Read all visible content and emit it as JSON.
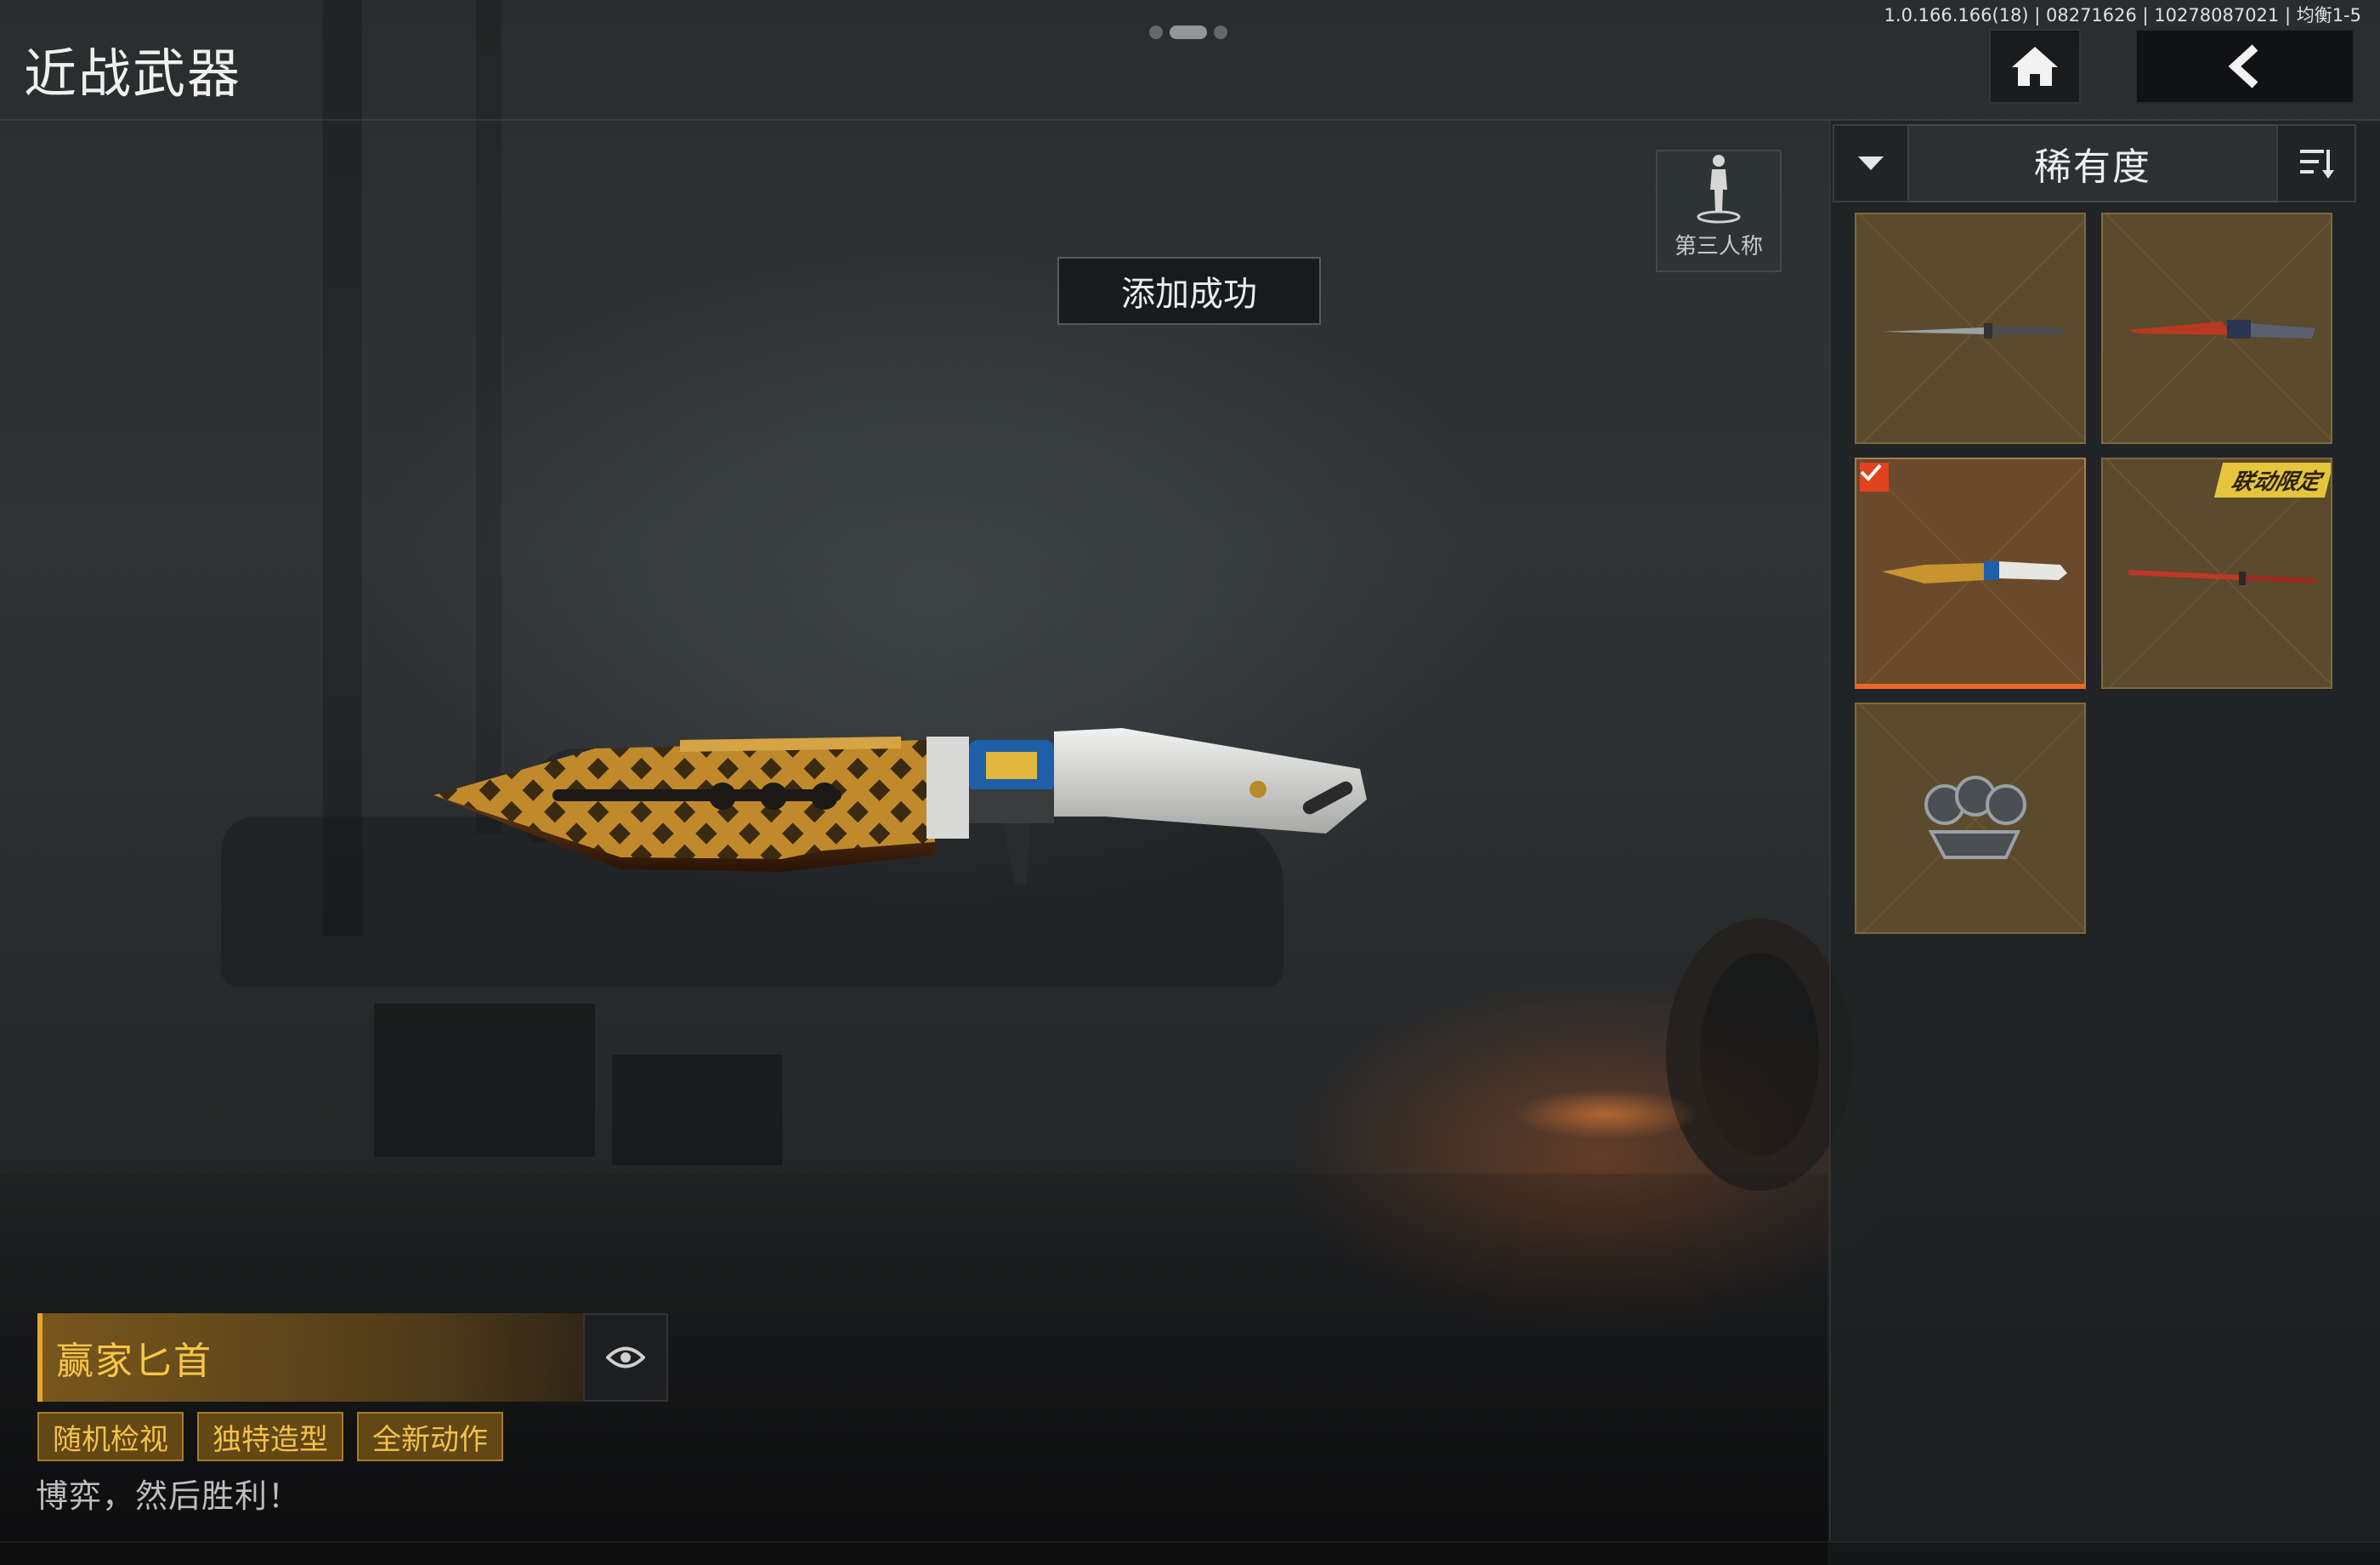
{
  "header": {
    "title": "近战武器",
    "status_text": "1.0.166.166(18) | 08271626 | 10278087021 | 均衡1-5"
  },
  "toast": {
    "message": "添加成功"
  },
  "view_toggle": {
    "label": "第三人称",
    "icon": "person-icon"
  },
  "sort": {
    "label": "稀有度",
    "dropdown_icon": "chevron-down-icon",
    "order_icon": "sort-order-icon"
  },
  "inventory": {
    "items": [
      {
        "id": "bayonet",
        "selected": false,
        "badge": ""
      },
      {
        "id": "red-blade",
        "selected": false,
        "badge": ""
      },
      {
        "id": "winner-dagger",
        "selected": true,
        "badge": ""
      },
      {
        "id": "red-katana",
        "selected": false,
        "badge": "联动限定"
      },
      {
        "id": "knuckles",
        "selected": false,
        "badge": ""
      }
    ]
  },
  "weapon_info": {
    "name": "赢家匕首",
    "tags": [
      "随机检视",
      "独特造型",
      "全新动作"
    ],
    "description": "博弈，然后胜利！",
    "preview_icon": "eye-icon"
  },
  "colors": {
    "accent_gold": "#f6c64a",
    "card_bg": "#5c4a2c",
    "selected_underline": "#e8682a",
    "check_red": "#e2431e"
  }
}
